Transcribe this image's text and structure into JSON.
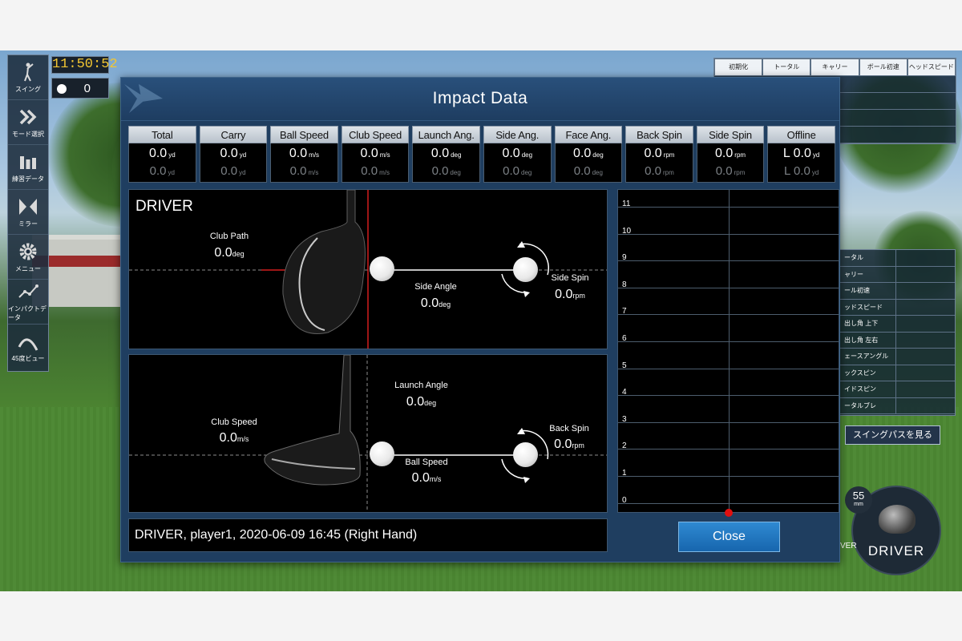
{
  "hud": {
    "clock": "11:50:52",
    "ball_count": "0"
  },
  "side_menu": {
    "items": [
      {
        "label": "スイング",
        "icon": "golfer-icon"
      },
      {
        "label": "モード選択",
        "icon": "double-chevron-icon"
      },
      {
        "label": "練習データ",
        "icon": "bar-chart-icon"
      },
      {
        "label": "ミラー",
        "icon": "mirror-icon"
      },
      {
        "label": "メニュー",
        "icon": "gear-icon"
      },
      {
        "label": "インパクトデータ",
        "icon": "line-chart-icon"
      },
      {
        "label": "45度ビュー",
        "icon": "arc-icon"
      }
    ]
  },
  "right_table": {
    "headers": [
      "初期化",
      "トータル",
      "キャリー",
      "ボール初速",
      "ヘッドスピード"
    ]
  },
  "right_stats": {
    "rows": [
      "ータル",
      "ャリー",
      "ール初速",
      "ッドスピード",
      "出し角 上下",
      "出し角 左右",
      "ェースアングル",
      "ックスピン",
      "イドスピン",
      "ータルブレ"
    ]
  },
  "swing_path_button": "スイングパスを見る",
  "club_badge": {
    "loft": "55",
    "loft_unit": "mm",
    "label": "DRIVER",
    "side_text": "VER"
  },
  "modal": {
    "title": "Impact Data",
    "stats": [
      {
        "label": "Total",
        "value": "0.0",
        "unit": "yd",
        "prev": "0.0",
        "prev_unit": "yd"
      },
      {
        "label": "Carry",
        "value": "0.0",
        "unit": "yd",
        "prev": "0.0",
        "prev_unit": "yd"
      },
      {
        "label": "Ball Speed",
        "value": "0.0",
        "unit": "m/s",
        "prev": "0.0",
        "prev_unit": "m/s"
      },
      {
        "label": "Club Speed",
        "value": "0.0",
        "unit": "m/s",
        "prev": "0.0",
        "prev_unit": "m/s"
      },
      {
        "label": "Launch Ang.",
        "value": "0.0",
        "unit": "deg",
        "prev": "0.0",
        "prev_unit": "deg"
      },
      {
        "label": "Side Ang.",
        "value": "0.0",
        "unit": "deg",
        "prev": "0.0",
        "prev_unit": "deg"
      },
      {
        "label": "Face Ang.",
        "value": "0.0",
        "unit": "deg",
        "prev": "0.0",
        "prev_unit": "deg"
      },
      {
        "label": "Back Spin",
        "value": "0.0",
        "unit": "rpm",
        "prev": "0.0",
        "prev_unit": "rpm"
      },
      {
        "label": "Side Spin",
        "value": "0.0",
        "unit": "rpm",
        "prev": "0.0",
        "prev_unit": "rpm"
      },
      {
        "label": "Offline",
        "value": "L 0.0",
        "unit": "yd",
        "prev": "L 0.0",
        "prev_unit": "yd"
      }
    ],
    "top_view": {
      "club": "DRIVER",
      "club_path_label": "Club Path",
      "club_path_value": "0.0",
      "club_path_unit": "deg",
      "side_angle_label": "Side Angle",
      "side_angle_value": "0.0",
      "side_angle_unit": "deg",
      "side_spin_label": "Side Spin",
      "side_spin_value": "0.0",
      "side_spin_unit": "rpm"
    },
    "side_view": {
      "club_speed_label": "Club Speed",
      "club_speed_value": "0.0",
      "club_speed_unit": "m/s",
      "launch_angle_label": "Launch Angle",
      "launch_angle_value": "0.0",
      "launch_angle_unit": "deg",
      "ball_speed_label": "Ball Speed",
      "ball_speed_value": "0.0",
      "ball_speed_unit": "m/s",
      "back_spin_label": "Back Spin",
      "back_spin_value": "0.0",
      "back_spin_unit": "rpm"
    },
    "trajectory": {
      "levels": [
        "11",
        "10",
        "9",
        "8",
        "7",
        "6",
        "5",
        "4",
        "3",
        "2",
        "1",
        "0"
      ]
    },
    "info": "DRIVER, player1, 2020-06-09 16:45 (Right Hand)",
    "close_label": "Close"
  }
}
